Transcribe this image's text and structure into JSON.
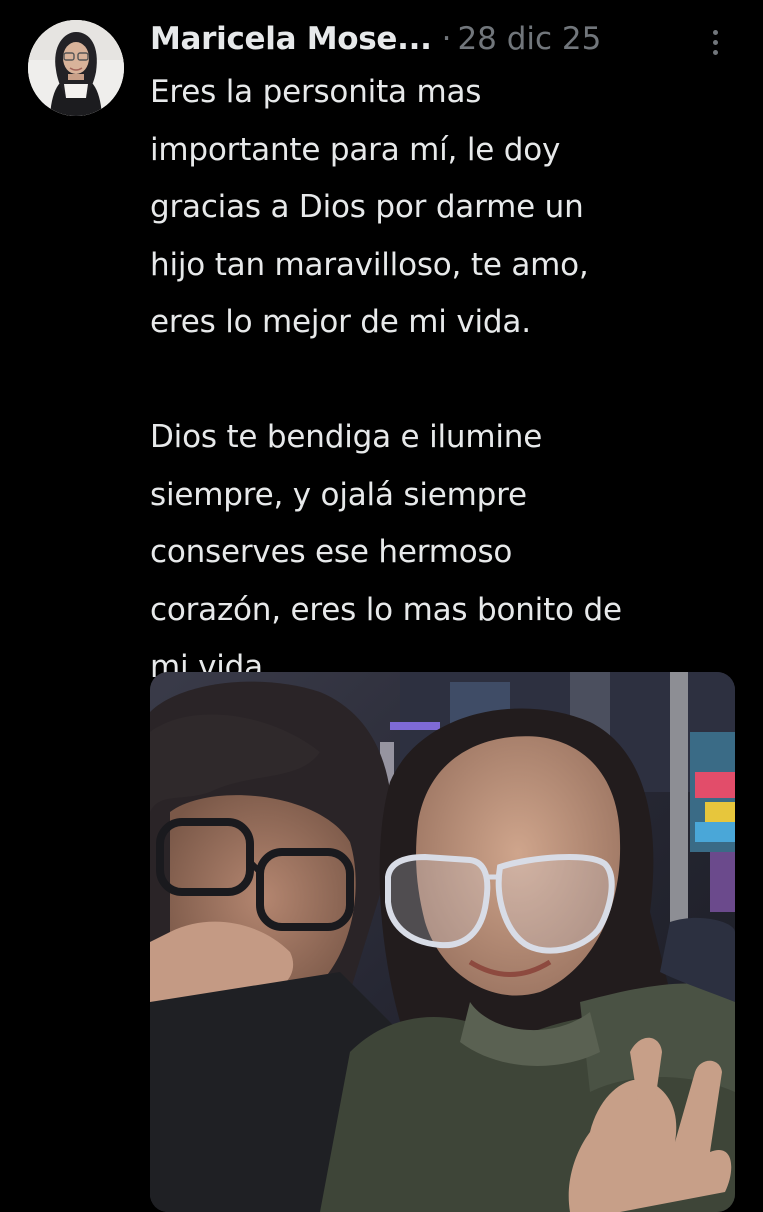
{
  "tweet": {
    "author": {
      "display_name": "Maricela Mose...",
      "avatar_icon": "profile-photo"
    },
    "separator": "·",
    "timestamp": "28 dic 25",
    "more_icon": "more-vertical-icon",
    "text_paragraphs": [
      [
        "Eres la personita mas",
        "importante para mí, le doy",
        "gracias a Dios por darme un",
        "hijo tan maravilloso, te amo,",
        "eres lo mejor de mi vida."
      ],
      [
        "Dios te bendiga e ilumine",
        "siempre, y ojalá siempre",
        "conserves ese hermoso",
        "corazón, eres lo mas bonito de",
        "mi vida."
      ]
    ],
    "media": {
      "type": "photo"
    }
  },
  "colors": {
    "background": "#000000",
    "text_primary": "#e7e9ea",
    "text_secondary": "#71767b"
  }
}
